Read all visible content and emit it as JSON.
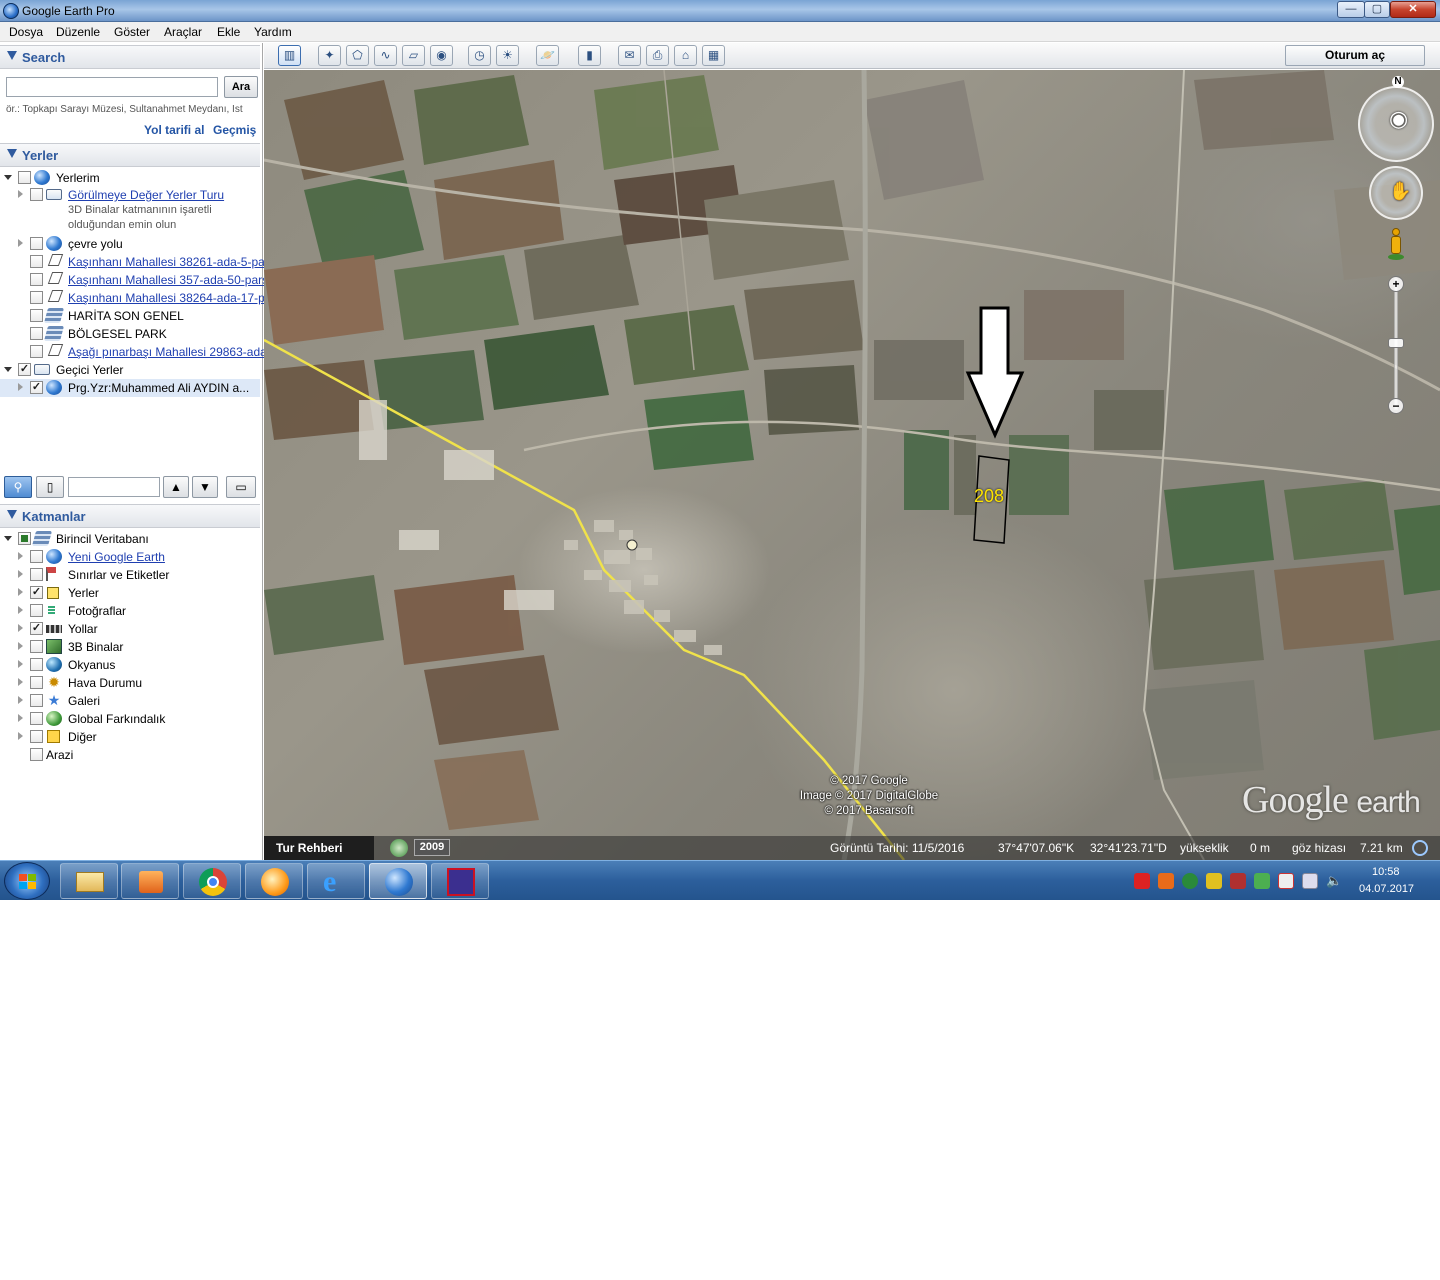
{
  "window": {
    "title": "Google Earth Pro",
    "btn_min": "—",
    "btn_max": "▢",
    "btn_close": "✕"
  },
  "menu": [
    "Dosya",
    "Düzenle",
    "Göster",
    "Araçlar",
    "Ekle",
    "Yardım"
  ],
  "search": {
    "header": "Search",
    "button": "Ara",
    "hint": "ör.: Topkapı Sarayı Müzesi, Sultanahmet Meydanı, İst",
    "directions_link": "Yol tarifi al",
    "history_link": "Geçmiş"
  },
  "places": {
    "header": "Yerler",
    "items": [
      {
        "label": "Yerlerim"
      },
      {
        "label": "Görülmeye Değer Yerler Turu"
      },
      {
        "label": "3D Binalar katmanının işaretli"
      },
      {
        "label": "olduğundan emin olun"
      },
      {
        "label": "çevre yolu"
      },
      {
        "label": "Kaşınhanı Mahallesi 38261-ada-5-pa"
      },
      {
        "label": "Kaşınhanı Mahallesi 357-ada-50-pars"
      },
      {
        "label": "Kaşınhanı Mahallesi 38264-ada-17-p"
      },
      {
        "label": "HARİTA SON GENEL"
      },
      {
        "label": "BÖLGESEL PARK"
      },
      {
        "label": "Aşağı pınarbaşı Mahallesi 29863-ada"
      },
      {
        "label": "Geçici Yerler"
      },
      {
        "label": "Prg.Yzr:Muhammed Ali AYDIN  a..."
      }
    ]
  },
  "layers": {
    "header": "Katmanlar",
    "items": [
      {
        "label": "Birincil Veritabanı"
      },
      {
        "label": "Yeni Google Earth"
      },
      {
        "label": "Sınırlar ve Etiketler"
      },
      {
        "label": "Yerler"
      },
      {
        "label": "Fotoğraflar"
      },
      {
        "label": "Yollar"
      },
      {
        "label": "3B Binalar"
      },
      {
        "label": "Okyanus"
      },
      {
        "label": "Hava Durumu"
      },
      {
        "label": "Galeri"
      },
      {
        "label": "Global Farkındalık"
      },
      {
        "label": "Diğer"
      },
      {
        "label": "Arazi"
      }
    ]
  },
  "toolbar": {
    "signin": "Oturum aç"
  },
  "map": {
    "attribution": [
      "© 2017 Google",
      "Image © 2017 DigitalGlobe",
      "© 2017 Basarsoft"
    ],
    "logo_main": "Google",
    "logo_small": "earth",
    "parcel_label": "208",
    "compass_n": "N"
  },
  "statusbar": {
    "tour": "Tur Rehberi",
    "year": "2009",
    "image_date": "Görüntü Tarihi: 11/5/2016",
    "lat": "37°47'07.06\"K",
    "lon": "32°41'23.71\"D",
    "elev_label": "yükseklik",
    "elev_value": "0 m",
    "eye_label": "göz hizası",
    "eye_value": "7.21 km"
  },
  "taskbar": {
    "time": "10:58",
    "date": "04.07.2017"
  },
  "colors": {
    "accent": "#2f5a9e",
    "link": "#1f3fb0",
    "road": "#f0e24a",
    "parcel_label": "#ffe400"
  }
}
